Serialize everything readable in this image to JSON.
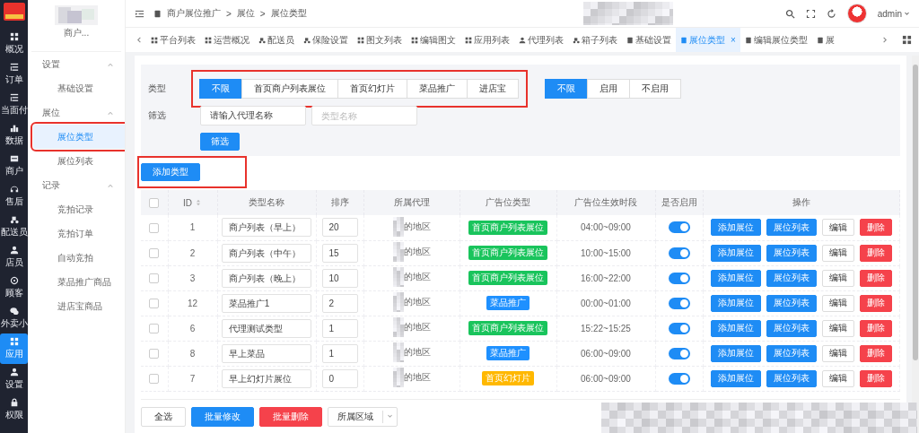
{
  "rail": {
    "items": [
      {
        "label": "概况",
        "selected": false
      },
      {
        "label": "订单",
        "selected": false
      },
      {
        "label": "当面付",
        "selected": false
      },
      {
        "label": "数据",
        "selected": false
      },
      {
        "label": "商户",
        "selected": false
      },
      {
        "label": "售后",
        "selected": false
      },
      {
        "label": "配送员",
        "selected": false
      },
      {
        "label": "店员",
        "selected": false
      },
      {
        "label": "顾客",
        "selected": false
      },
      {
        "label": "外卖小",
        "selected": false
      },
      {
        "label": "应用",
        "selected": true
      },
      {
        "label": "设置",
        "selected": false
      },
      {
        "label": "权限",
        "selected": false
      }
    ]
  },
  "subnav": {
    "shop_name": "商户...",
    "groups": [
      {
        "title": "设置",
        "expanded": true,
        "children": [
          {
            "label": "基础设置",
            "selected": false,
            "highlighted": false
          }
        ]
      },
      {
        "title": "展位",
        "expanded": true,
        "children": [
          {
            "label": "展位类型",
            "selected": true,
            "highlighted": true
          },
          {
            "label": "展位列表",
            "selected": false,
            "highlighted": false
          }
        ]
      },
      {
        "title": "记录",
        "expanded": true,
        "children": [
          {
            "label": "竞拍记录",
            "selected": false,
            "highlighted": false
          },
          {
            "label": "竞拍订单",
            "selected": false,
            "highlighted": false
          },
          {
            "label": "自动竞拍",
            "selected": false,
            "highlighted": false
          },
          {
            "label": "菜品推广商品",
            "selected": false,
            "highlighted": false
          },
          {
            "label": "进店宝商品",
            "selected": false,
            "highlighted": false
          }
        ]
      }
    ]
  },
  "header": {
    "breadcrumb": [
      "商户展位推广",
      "展位",
      "展位类型"
    ],
    "separator": ">",
    "user": "admin"
  },
  "tabs": [
    {
      "label": "平台列表",
      "selected": false
    },
    {
      "label": "运营概况",
      "selected": false
    },
    {
      "label": "配送员",
      "selected": false
    },
    {
      "label": "保险设置",
      "selected": false
    },
    {
      "label": "图文列表",
      "selected": false
    },
    {
      "label": "编辑图文",
      "selected": false
    },
    {
      "label": "应用列表",
      "selected": false
    },
    {
      "label": "代理列表",
      "selected": false
    },
    {
      "label": "箱子列表",
      "selected": false
    },
    {
      "label": "基础设置",
      "selected": false
    },
    {
      "label": "展位类型",
      "selected": true,
      "close": "×"
    },
    {
      "label": "编辑展位类型",
      "selected": false
    },
    {
      "label": "展",
      "selected": false
    }
  ],
  "filters": {
    "type_label": "类型",
    "highlighted": true,
    "type_options": [
      {
        "label": "不限",
        "selected": true
      },
      {
        "label": "首页商户列表展位",
        "selected": false
      },
      {
        "label": "首页幻灯片",
        "selected": false
      },
      {
        "label": "菜品推广",
        "selected": false
      },
      {
        "label": "进店宝",
        "selected": false
      }
    ],
    "status_options": [
      {
        "label": "不限",
        "selected": true
      },
      {
        "label": "启用",
        "selected": false
      },
      {
        "label": "不启用",
        "selected": false
      }
    ],
    "search_label": "筛选",
    "agent_field": {
      "value": "请输入代理名称"
    },
    "name_field": {
      "placeholder": "类型名称"
    },
    "search_button": "筛选"
  },
  "add_button": {
    "label": "添加类型",
    "highlighted": true
  },
  "table": {
    "header_checkbox": {
      "checked": false
    },
    "columns": [
      {
        "label": "ID",
        "sortable": true
      },
      {
        "label": "类型名称",
        "sortable": false
      },
      {
        "label": "排序",
        "sortable": false
      },
      {
        "label": "所属代理",
        "sortable": false
      },
      {
        "label": "广告位类型",
        "sortable": false
      },
      {
        "label": "广告位生效时段",
        "sortable": false
      },
      {
        "label": "是否启用",
        "sortable": false
      },
      {
        "label": "操作",
        "sortable": false
      }
    ],
    "rows": [
      {
        "checked": false,
        "id": "1",
        "name": "商户列表（早上）",
        "sort": "20",
        "agent": "的地区",
        "ad_type": {
          "label": "首页商户列表展位",
          "color": "#19c45c"
        },
        "time": "04:00~09:00",
        "enabled": true,
        "actions": [
          {
            "label": "添加展位",
            "kind": "primary"
          },
          {
            "label": "展位列表",
            "kind": "primary"
          },
          {
            "label": "编辑",
            "kind": "default"
          },
          {
            "label": "删除",
            "kind": "danger"
          }
        ]
      },
      {
        "checked": false,
        "id": "2",
        "name": "商户列表（中午）",
        "sort": "15",
        "agent": "的地区",
        "ad_type": {
          "label": "首页商户列表展位",
          "color": "#19c45c"
        },
        "time": "10:00~15:00",
        "enabled": true,
        "actions": [
          {
            "label": "添加展位",
            "kind": "primary"
          },
          {
            "label": "展位列表",
            "kind": "primary"
          },
          {
            "label": "编辑",
            "kind": "default"
          },
          {
            "label": "删除",
            "kind": "danger"
          }
        ]
      },
      {
        "checked": false,
        "id": "3",
        "name": "商户列表（晚上）",
        "sort": "10",
        "agent": "的地区",
        "ad_type": {
          "label": "首页商户列表展位",
          "color": "#19c45c"
        },
        "time": "16:00~22:00",
        "enabled": true,
        "actions": [
          {
            "label": "添加展位",
            "kind": "primary"
          },
          {
            "label": "展位列表",
            "kind": "primary"
          },
          {
            "label": "编辑",
            "kind": "default"
          },
          {
            "label": "删除",
            "kind": "danger"
          }
        ]
      },
      {
        "checked": false,
        "id": "12",
        "name": "菜品推广1",
        "sort": "2",
        "agent": "的地区",
        "ad_type": {
          "label": "菜品推广",
          "color": "#1e90ff"
        },
        "time": "00:00~01:00",
        "enabled": true,
        "actions": [
          {
            "label": "添加展位",
            "kind": "primary"
          },
          {
            "label": "展位列表",
            "kind": "primary"
          },
          {
            "label": "编辑",
            "kind": "default"
          },
          {
            "label": "删除",
            "kind": "danger"
          }
        ]
      },
      {
        "checked": false,
        "id": "6",
        "name": "代理测试类型",
        "sort": "1",
        "agent": "的地区",
        "ad_type": {
          "label": "首页商户列表展位",
          "color": "#19c45c"
        },
        "time": "15:22~15:25",
        "enabled": true,
        "actions": [
          {
            "label": "添加展位",
            "kind": "primary"
          },
          {
            "label": "展位列表",
            "kind": "primary"
          },
          {
            "label": "编辑",
            "kind": "default"
          },
          {
            "label": "删除",
            "kind": "danger"
          }
        ]
      },
      {
        "checked": false,
        "id": "8",
        "name": "早上菜品",
        "sort": "1",
        "agent": "的地区",
        "ad_type": {
          "label": "菜品推广",
          "color": "#1e90ff"
        },
        "time": "06:00~09:00",
        "enabled": true,
        "actions": [
          {
            "label": "添加展位",
            "kind": "primary"
          },
          {
            "label": "展位列表",
            "kind": "primary"
          },
          {
            "label": "编辑",
            "kind": "default"
          },
          {
            "label": "删除",
            "kind": "danger"
          }
        ]
      },
      {
        "checked": false,
        "id": "7",
        "name": "早上幻灯片展位",
        "sort": "0",
        "agent": "的地区",
        "ad_type": {
          "label": "首页幻灯片",
          "color": "#ffb800"
        },
        "time": "06:00~09:00",
        "enabled": true,
        "actions": [
          {
            "label": "添加展位",
            "kind": "primary"
          },
          {
            "label": "展位列表",
            "kind": "primary"
          },
          {
            "label": "编辑",
            "kind": "default"
          },
          {
            "label": "删除",
            "kind": "danger"
          }
        ]
      }
    ]
  },
  "footer": {
    "buttons": [
      {
        "label": "全选",
        "kind": "default"
      },
      {
        "label": "批量修改",
        "kind": "primary"
      },
      {
        "label": "批量删除",
        "kind": "danger"
      }
    ],
    "region_select": {
      "value": "所属区域"
    }
  }
}
